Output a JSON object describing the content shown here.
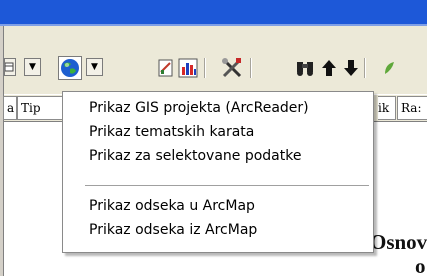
{
  "colors": {
    "title_band": "#1d58d8",
    "toolbar_bg": "#ece9d8",
    "menu_border": "#8a8a8a"
  },
  "toolbar": {
    "icons": [
      "dropdown-arrow-icon",
      "globe-icon",
      "dropdown-arrow-icon",
      "report-icon",
      "bar-chart-icon",
      "tools-icon",
      "binoculars-icon",
      "arrow-up-icon",
      "arrow-down-icon"
    ]
  },
  "tabs": [
    {
      "label": "a"
    },
    {
      "label": "Tip"
    },
    {
      "label": "ik"
    },
    {
      "label": "Ra:"
    }
  ],
  "menu": {
    "items": [
      {
        "label": "Prikaz GIS projekta (ArcReader)"
      },
      {
        "label": "Prikaz tematskih karata"
      },
      {
        "label": "Prikaz za selektovane podatke"
      },
      {
        "label": "Prikaz odseka u ArcMap"
      },
      {
        "label": "Prikaz odseka iz ArcMap"
      }
    ]
  },
  "document": {
    "heading_fragment": "Osnov",
    "second_fragment": "o"
  }
}
